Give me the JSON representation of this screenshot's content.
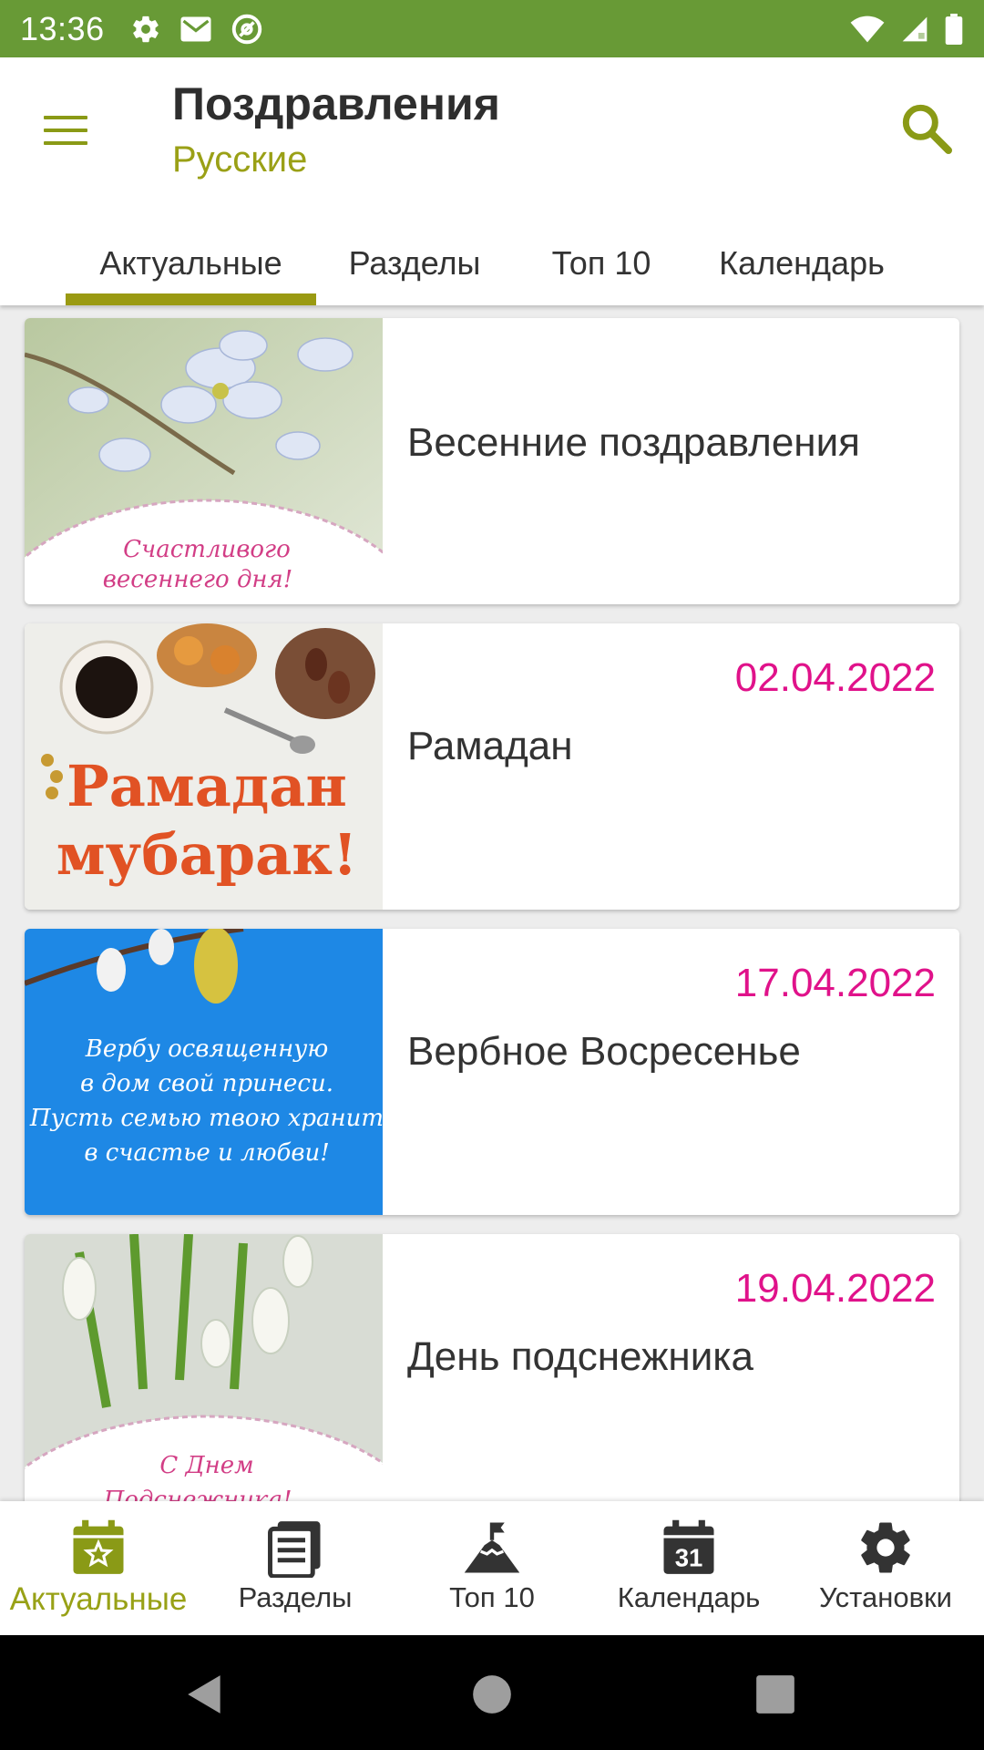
{
  "status_bar": {
    "time": "13:36",
    "left_icons": [
      "gear-icon",
      "mail-icon",
      "at-sign-icon"
    ],
    "right_icons": [
      "wifi-icon",
      "signal-icon",
      "battery-icon"
    ],
    "background": "#689a36"
  },
  "app_bar": {
    "title": "Поздравления",
    "subtitle": "Русские",
    "accent": "#9a9a12"
  },
  "tabs": [
    {
      "label": "Актуальные",
      "active": true
    },
    {
      "label": "Разделы",
      "active": false
    },
    {
      "label": "Топ 10",
      "active": false
    },
    {
      "label": "Календарь",
      "active": false
    }
  ],
  "cards": [
    {
      "title": "Весенние поздравления",
      "date": "",
      "image_caption": "Счастливого весеннего дня!"
    },
    {
      "title": "Рамадан",
      "date": "02.04.2022",
      "image_caption": "Рамадан мубарак!"
    },
    {
      "title": "Вербное Восресенье",
      "date": "17.04.2022",
      "image_caption": "Вербу освященную в дом свой принеси. Пусть семью твою хранит в счастье и любви!"
    },
    {
      "title": "День подснежника",
      "date": "19.04.2022",
      "image_caption": "С Днем Подснежника!"
    }
  ],
  "date_color": "#e0128a",
  "bottom_nav": [
    {
      "label": "Актуальные",
      "icon": "calendar-star-icon",
      "active": true
    },
    {
      "label": "Разделы",
      "icon": "list-document-icon",
      "active": false
    },
    {
      "label": "Топ 10",
      "icon": "mountain-flag-icon",
      "active": false
    },
    {
      "label": "Календарь",
      "icon": "calendar-31-icon",
      "active": false
    },
    {
      "label": "Установки",
      "icon": "settings-gear-icon",
      "active": false
    }
  ],
  "calendar_icon_day": "31"
}
